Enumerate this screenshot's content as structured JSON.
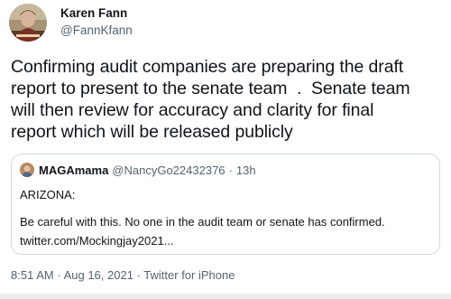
{
  "tweet": {
    "author": {
      "display_name": "Karen Fann",
      "handle": "@FannKfann",
      "avatar_icon": "profile-photo"
    },
    "text_lines": [
      "Confirming audit companies are preparing the draft",
      "report to present to the senate team  .  Senate team",
      "will then review for accuracy and clarity for final",
      "report which will be released publicly"
    ],
    "quoted": {
      "display_name": "MAGAmama",
      "handle": "@NancyGo22432376",
      "separator": "·",
      "time": "13h",
      "line1": "ARIZONA:",
      "line2": "Be careful with this. No one in the audit team or senate has confirmed.",
      "line3": "twitter.com/Mockingjay2021..."
    },
    "meta": {
      "time": "8:51 AM",
      "sep1": "·",
      "date": "Aug 16, 2021",
      "sep2": "·",
      "client": "Twitter for iPhone"
    }
  },
  "colors": {
    "text": "#0f1419",
    "secondary": "#536471",
    "border": "#cfd9de"
  }
}
